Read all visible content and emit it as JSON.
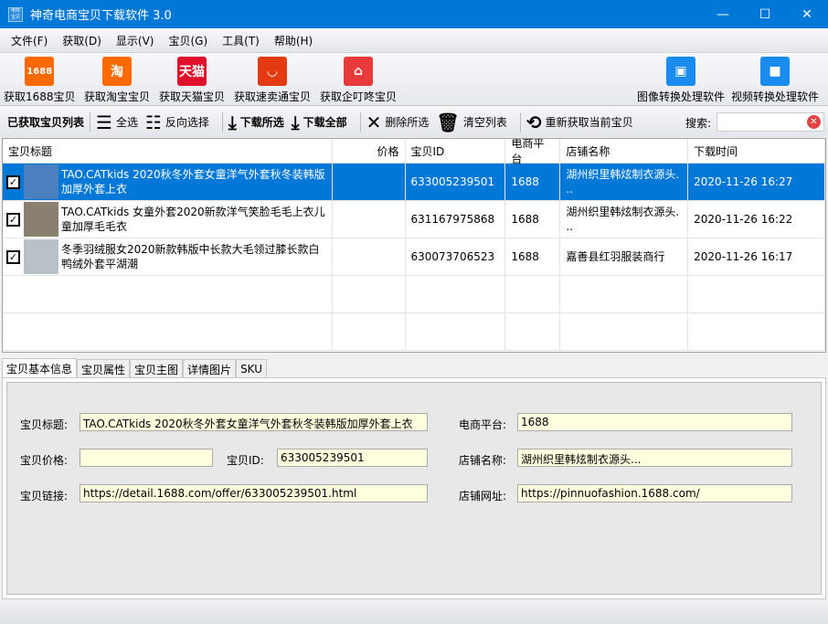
{
  "window": {
    "title": "神奇电商宝贝下载软件 3.0",
    "icon_text": "电商宝贝",
    "minimize": "—",
    "maximize": "☐",
    "close": "✕"
  },
  "menu": [
    "文件(F)",
    "获取(D)",
    "显示(V)",
    "宝贝(G)",
    "工具(T)",
    "帮助(H)"
  ],
  "big_toolbar": [
    {
      "label": "获取1688宝贝",
      "icon": "1688-icon",
      "icon_text": "1688",
      "color": "#ff6a00"
    },
    {
      "label": "获取淘宝宝贝",
      "icon": "taobao-icon",
      "icon_text": "淘",
      "color": "#ff6a00"
    },
    {
      "label": "获取天猫宝贝",
      "icon": "tmall-icon",
      "icon_text": "天猫",
      "color": "#e0102a"
    },
    {
      "label": "获取速卖通宝贝",
      "icon": "aliexpress-icon",
      "icon_text": "◡",
      "color": "#e43a12"
    },
    {
      "label": "获取企叮咚宝贝",
      "icon": "qidingdong-icon",
      "icon_text": "⌂",
      "color": "#e83a3a"
    },
    {
      "label": "图像转换处理软件",
      "icon": "image-convert-icon",
      "icon_text": "▣",
      "color": "#1a8cf0"
    },
    {
      "label": "视频转换处理软件",
      "icon": "video-convert-icon",
      "icon_text": "■",
      "color": "#1a8cf0"
    }
  ],
  "small_toolbar": {
    "list_label": "已获取宝贝列表",
    "select_all": "全选",
    "invert": "反向选择",
    "download_selected": "下载所选",
    "download_all": "下载全部",
    "delete_selected": "删除所选",
    "clear_list": "清空列表",
    "refetch": "重新获取当前宝贝",
    "search_label": "搜索:",
    "search_value": ""
  },
  "table": {
    "headers": [
      "宝贝标题",
      "价格",
      "宝贝ID",
      "电商平台",
      "店铺名称",
      "下载时间"
    ],
    "rows": [
      {
        "checked": true,
        "title": "TAO.CATkids 2020秋冬外套女童洋气外套秋冬装韩版加厚外套上衣",
        "price": "",
        "id": "633005239501",
        "platform": "1688",
        "shop": "湖州织里韩炫制衣源头. ..",
        "time": "2020-11-26 16:27"
      },
      {
        "checked": true,
        "title": "TAO.CATkids 女童外套2020新款洋气笑脸毛毛上衣儿童加厚毛毛衣",
        "price": "",
        "id": "631167975868",
        "platform": "1688",
        "shop": "湖州织里韩炫制衣源头. ..",
        "time": "2020-11-26 16:22"
      },
      {
        "checked": true,
        "title": "冬季羽绒服女2020新款韩版中长款大毛领过膝长款白鸭绒外套平湖潮",
        "price": "",
        "id": "630073706523",
        "platform": "1688",
        "shop": "嘉善县红羽服装商行",
        "time": "2020-11-26 16:17"
      }
    ]
  },
  "tabs": [
    "宝贝基本信息",
    "宝贝属性",
    "宝贝主图",
    "详情图片",
    "SKU"
  ],
  "details": {
    "title_label": "宝贝标题:",
    "title": "TAO.CATkids 2020秋冬外套女童洋气外套秋冬装韩版加厚外套上衣",
    "platform_label": "电商平台:",
    "platform": "1688",
    "price_label": "宝贝价格:",
    "price": "",
    "id_label": "宝贝ID:",
    "id": "633005239501",
    "shop_label": "店铺名称:",
    "shop": "湖州织里韩炫制衣源头...",
    "link_label": "宝贝链接:",
    "link": "https://detail.1688.com/offer/633005239501.html",
    "shop_url_label": "店铺网址:",
    "shop_url": "https://pinnuofashion.1688.com/"
  }
}
